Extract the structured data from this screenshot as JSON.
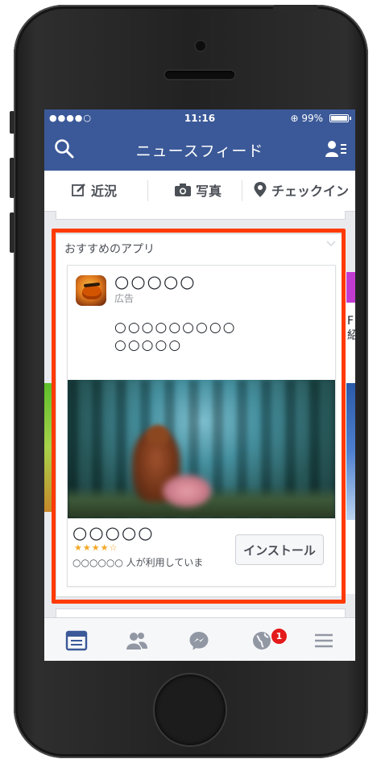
{
  "status_bar": {
    "signal": "●●●●○",
    "time": "11:16",
    "battery_text": "99%",
    "battery_level": 0.99
  },
  "nav": {
    "title": "ニュースフィード",
    "search_icon": "search-icon",
    "friends_icon": "friend-requests-icon"
  },
  "actions": {
    "status": "近況",
    "photo": "写真",
    "checkin": "チェックイン"
  },
  "card": {
    "header": "おすすめのアプリ",
    "app_name": "○○○○○",
    "ad_label": "広告",
    "description_line1": "○○○○○○○○○",
    "description_line2": "○○○○○",
    "app_name_bottom": "○○○○○",
    "rating": 4.5,
    "stars": "★★★★☆",
    "users_text": "○○○○○○ 人が利用していま",
    "install_label": "インストール"
  },
  "peek": {
    "right_text": "F\n紹"
  },
  "tabbar": {
    "notification_count": "1"
  },
  "colors": {
    "facebook_blue": "#3b5998",
    "highlight": "#ff3a00",
    "badge": "#e41b1b",
    "stars": "#f5a623"
  }
}
